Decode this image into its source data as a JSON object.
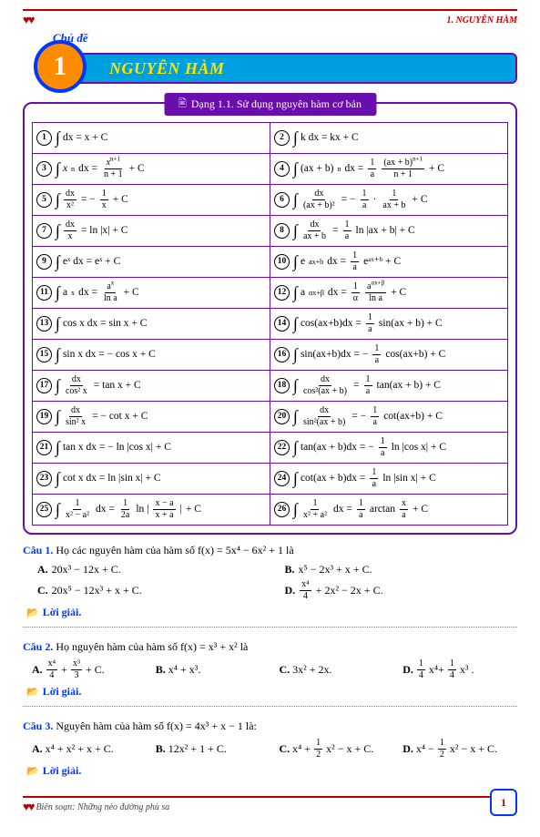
{
  "header": {
    "section": "1. NGUYÊN HÀM"
  },
  "chapter": {
    "label": "Chủ đề",
    "number": "1",
    "title": "NGUYÊN HÀM"
  },
  "box": {
    "tab_label": "Dạng 1.1. Sử dụng nguyên hàm cơ bản"
  },
  "formulas": {
    "r1l": "dx = x + C",
    "r1r": "k dx = kx + C",
    "r7l_pre": "",
    "r7l_post": " = ln |x| + C",
    "r8l_post": " ln |ax + b| + C",
    "r9l": "eˣ dx = eˣ + C",
    "r10r_post": "eᵃˣ⁺ᵇ + C",
    "r11_post": " + C",
    "r12_post": " + C",
    "r13l": "cos x dx = sin x + C",
    "r14r": " sin(ax + b) + C",
    "r15l": "sin x dx = − cos x + C",
    "r16r": " cos(ax+b) + C",
    "r17_post": " = tan x + C",
    "r18_post": " tan(ax + b) + C",
    "r19_post": " = − cot x + C",
    "r20_post": " cot(ax+b) + C",
    "r21l": "tan x dx = − ln |cos x| + C",
    "r22r": " ln |cos x| + C",
    "r23l": "cot x dx = ln |sin x| + C",
    "r24r": " ln |sin x| + C",
    "r25_post": " + C",
    "r26_post": " + C"
  },
  "q1": {
    "title": "Câu 1.",
    "text": "Họ các nguyên hàm của hàm số f(x) = 5x⁴ − 6x² + 1 là",
    "A": "20x³ − 12x + C.",
    "B": "x⁵ − 2x³ + x + C.",
    "C": "20x⁵ − 12x³ + x + C.",
    "D_post": " + 2x² − 2x + C."
  },
  "q2": {
    "title": "Câu 2.",
    "text": "Họ nguyên hàm của hàm số f(x) = x³ + x² là",
    "A_post": " + C.",
    "B": "x⁴ + x³.",
    "C": "3x² + 2x.",
    "D_post": "."
  },
  "q3": {
    "title": "Câu 3.",
    "text": "Nguyên hàm của hàm số f(x) = 4x³ + x − 1 là:",
    "A": "x⁴ + x² + x + C.",
    "B": "12x² + 1 + C.",
    "C_post": "x² − x + C.",
    "D_post": "x² − x + C."
  },
  "solution_label": "Lời giải.",
  "footer": {
    "author": "Biên soạn: Những nẻo đường phù sa",
    "page": "1"
  }
}
